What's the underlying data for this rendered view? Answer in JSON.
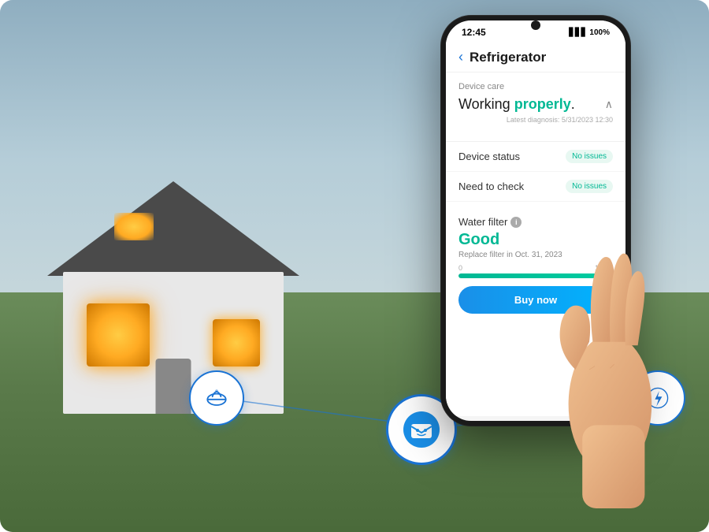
{
  "background": {
    "alt": "Smart home background with house"
  },
  "phone": {
    "status_bar": {
      "time": "12:45",
      "signal": "▋▋▋",
      "battery": "100%"
    },
    "header": {
      "back_label": "‹",
      "title": "Refrigerator"
    },
    "device_care": {
      "section_label": "Device care",
      "working_text": "Working ",
      "properly_text": "properly",
      "period": ".",
      "diagnosis_label": "Latest diagnosis: 5/31/2023 12:30",
      "chevron": "∧"
    },
    "status_items": [
      {
        "label": "Device status",
        "badge": "No issues"
      },
      {
        "label": "Need to check",
        "badge": "No issues"
      }
    ],
    "water_filter": {
      "title": "Water filter",
      "info": "i",
      "status": "Good",
      "replace_text": "Replace filter in Oct. 31, 2023",
      "progress_min": "0",
      "progress_max": "100%",
      "progress_value": 92,
      "buy_button": "Buy now"
    }
  },
  "icons": {
    "left": {
      "type": "bowl",
      "color": "#1a73d4"
    },
    "center": {
      "type": "smartthings",
      "color": "#1a73d4"
    },
    "right": {
      "type": "plug",
      "color": "#1a73d4"
    }
  }
}
